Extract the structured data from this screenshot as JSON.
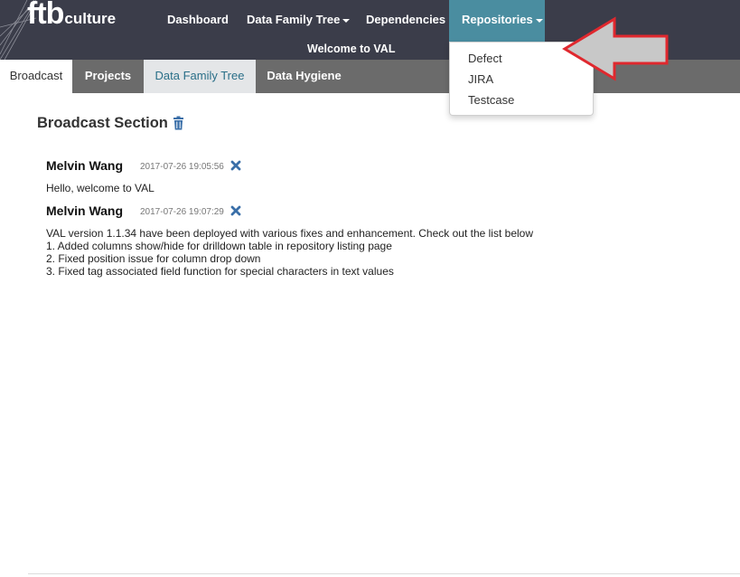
{
  "app": {
    "logo_main": "ftb",
    "logo_sub": "culture",
    "welcome": "Welcome to VAL"
  },
  "nav": {
    "items": [
      {
        "label": "Dashboard"
      },
      {
        "label": "Data Family Tree",
        "has_caret": true
      },
      {
        "label": "Dependencies"
      },
      {
        "label": "Repositories",
        "has_caret": true,
        "active": true
      }
    ]
  },
  "dropdown": {
    "items": [
      {
        "label": "Defect"
      },
      {
        "label": "JIRA"
      },
      {
        "label": "Testcase"
      }
    ]
  },
  "tabs": [
    {
      "label": "Broadcast",
      "state": "active"
    },
    {
      "label": "Projects",
      "state": "normal"
    },
    {
      "label": "Data Family Tree",
      "state": "highlighted"
    },
    {
      "label": "Data Hygiene",
      "state": "normal"
    }
  ],
  "broadcast": {
    "title": "Broadcast Section",
    "messages": [
      {
        "author": "Melvin Wang",
        "time": "2017-07-26 19:05:56",
        "lines": [
          "Hello, welcome to VAL"
        ]
      },
      {
        "author": "Melvin Wang",
        "time": "2017-07-26 19:07:29",
        "lines": [
          "VAL version 1.1.34 have been deployed with various fixes and enhancement. Check out the list below",
          "1. Added columns show/hide for drilldown table in repository listing page",
          "2. Fixed position issue for column drop down",
          "3. Fixed tag associated field function for special characters in text values"
        ]
      }
    ]
  },
  "colors": {
    "navbar": "#3b3d4a",
    "nav_active": "#4a8da0",
    "tabbar": "#6b6b6b",
    "link_blue": "#2a6f88",
    "icon_blue": "#3a6fa8",
    "arrow_red": "#e0282e",
    "arrow_fill": "#c8c8c8"
  },
  "icons": {
    "trash": "trash-icon",
    "close": "close-icon",
    "caret": "caret-down-icon"
  }
}
